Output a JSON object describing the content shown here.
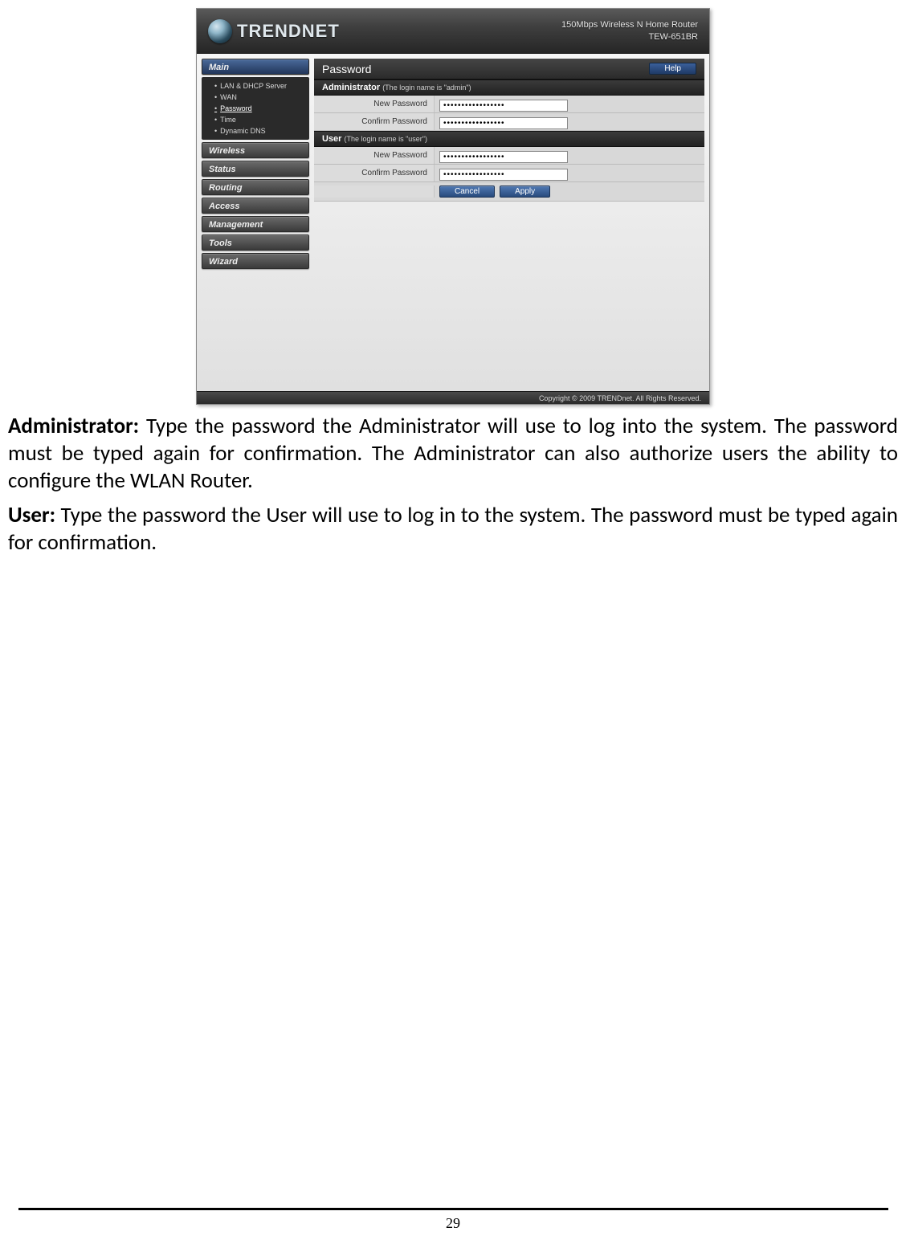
{
  "router": {
    "brand": "TRENDNET",
    "header": {
      "product_line": "150Mbps Wireless N Home Router",
      "model": "TEW-651BR"
    },
    "sidebar": {
      "sections": [
        {
          "label": "Main",
          "active": true
        },
        {
          "label": "Wireless"
        },
        {
          "label": "Status"
        },
        {
          "label": "Routing"
        },
        {
          "label": "Access"
        },
        {
          "label": "Management"
        },
        {
          "label": "Tools"
        },
        {
          "label": "Wizard"
        }
      ],
      "main_subitems": [
        {
          "label": "LAN & DHCP Server"
        },
        {
          "label": "WAN"
        },
        {
          "label": "Password",
          "selected": true
        },
        {
          "label": "Time"
        },
        {
          "label": "Dynamic DNS"
        }
      ]
    },
    "panel": {
      "title": "Password",
      "help": "Help",
      "admin": {
        "heading": "Administrator",
        "note": "(The login name is \"admin\")",
        "new_password_label": "New Password",
        "confirm_password_label": "Confirm Password",
        "new_password_value": "•••••••••••••••••",
        "confirm_password_value": "•••••••••••••••••"
      },
      "user": {
        "heading": "User",
        "note": "(The login name is \"user\")",
        "new_password_label": "New Password",
        "confirm_password_label": "Confirm Password",
        "new_password_value": "•••••••••••••••••",
        "confirm_password_value": "•••••••••••••••••"
      },
      "buttons": {
        "cancel": "Cancel",
        "apply": "Apply"
      }
    },
    "footer": "Copyright © 2009 TRENDnet. All Rights Reserved."
  },
  "body_text": {
    "p1_label": "Administrator:",
    "p1_rest": " Type the password the Administrator will use to log into the system. The password must be typed again for confirmation. The Administrator can also authorize users the ability to configure the WLAN Router.",
    "p2_label": "User:",
    "p2_rest": " Type the password the User will use to log in to the system. The password must be typed again for confirmation."
  },
  "page_number": "29"
}
